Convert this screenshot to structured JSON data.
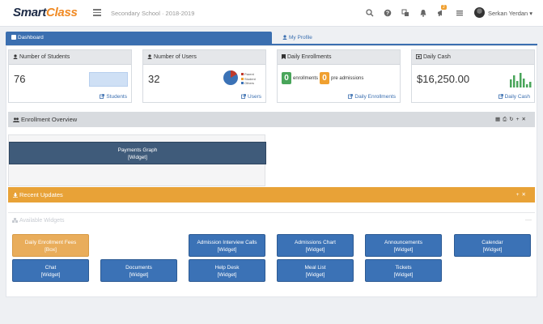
{
  "header": {
    "logo_part1": "Smart",
    "logo_part2": "Class",
    "school": "Secondary School · 2018-2019",
    "notification_count": "2",
    "user_name": "Serkan Yerdan ▾"
  },
  "tabs": [
    {
      "label": "Dashboard"
    },
    {
      "label": "My Profile"
    }
  ],
  "stats": [
    {
      "title": "Number of Students",
      "value": "76",
      "link": "Students"
    },
    {
      "title": "Number of Users",
      "value": "32",
      "link": "Users",
      "legend": [
        "Parent",
        "Student",
        "Others"
      ]
    },
    {
      "title": "Daily Enrollments",
      "count1": "0",
      "label1": "enrollments",
      "count2": "0",
      "label2": "pre admissions",
      "link": "Daily Enrollments"
    },
    {
      "title": "Daily Cash",
      "value": "$16,250.00",
      "link": "Daily Cash"
    }
  ],
  "colors": {
    "accent": "#3b6fb0",
    "orange": "#e8a237",
    "green": "#49a55a"
  },
  "enrollment": {
    "title": "Enrollment Overview",
    "graph_title": "Payments Graph",
    "graph_sub": "[Widget]"
  },
  "recent": {
    "title": "Recent Updates"
  },
  "available": {
    "title": "Available Widgets",
    "widgets": [
      {
        "title": "Daily Enrollment Fees",
        "sub": "[Box]"
      },
      {
        "title": "Admission Interview Calls",
        "sub": "[Widget]"
      },
      {
        "title": "Admissions Chart",
        "sub": "[Widget]"
      },
      {
        "title": "Announcements",
        "sub": "[Widget]"
      },
      {
        "title": "Calendar",
        "sub": "[Widget]"
      },
      {
        "title": "Chat",
        "sub": "[Widget]"
      },
      {
        "title": "Documents",
        "sub": "[Widget]"
      },
      {
        "title": "Help Desk",
        "sub": "[Widget]"
      },
      {
        "title": "Meal List",
        "sub": "[Widget]"
      },
      {
        "title": "Tickets",
        "sub": "[Widget]"
      }
    ]
  }
}
